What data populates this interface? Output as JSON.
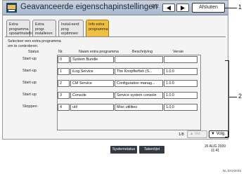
{
  "window": {
    "title": "Geavanceerde eigenschapinstellingen",
    "page": "2/2",
    "close_label": "Afsluiten"
  },
  "tabs": [
    {
      "label": "Extra programma\nopstartinstelling"
    },
    {
      "label": "Extra progr.\ninstalleren"
    },
    {
      "label": "Instal-eerd prog\nerpitmnen"
    },
    {
      "label": "Info extra\nprogramma"
    }
  ],
  "instruction": "Selecteer een extra programma\nom te controleren.",
  "columns": {
    "status": "Status",
    "nr": "Nr.",
    "name": "Naam extra programma",
    "description": "Beschrijving",
    "version": "Versie"
  },
  "rows": [
    {
      "status": "Start-up",
      "nr": "0",
      "name": "System Bundle",
      "description": "",
      "version": ""
    },
    {
      "status": "Start-up",
      "nr": "1",
      "name": "iLog Service",
      "description": "The Knopflerfish (S...",
      "version": "1.0.0"
    },
    {
      "status": "Start-up",
      "nr": "2",
      "name": "CM Service",
      "description": "Configuration manag...",
      "version": "1.0.0"
    },
    {
      "status": "Start-up",
      "nr": "3",
      "name": "Console",
      "description": "Service system console",
      "version": "1.0.0"
    },
    {
      "status": "Stoppen",
      "nr": "4",
      "name": "util",
      "description": "Misc utilities",
      "version": "1.0.0"
    }
  ],
  "pagination": {
    "count": "1/8",
    "prev_label": "▲ Vor.",
    "next_label": "▼ Volg."
  },
  "status_bar": {
    "system_status": "Systemstatus",
    "job_list": "Takenlijst",
    "date": "26 AUG 2009",
    "time": "11:41"
  },
  "callouts": {
    "one": "1",
    "two": "2"
  },
  "figure_ref": "NL BXX003S",
  "colors": {
    "titlebar": "#aab7cb",
    "active_tab": "#f0c040",
    "status_button": "#333a44"
  },
  "icons": [
    "app-icon",
    "arrow-left-icon",
    "arrow-right-icon"
  ]
}
